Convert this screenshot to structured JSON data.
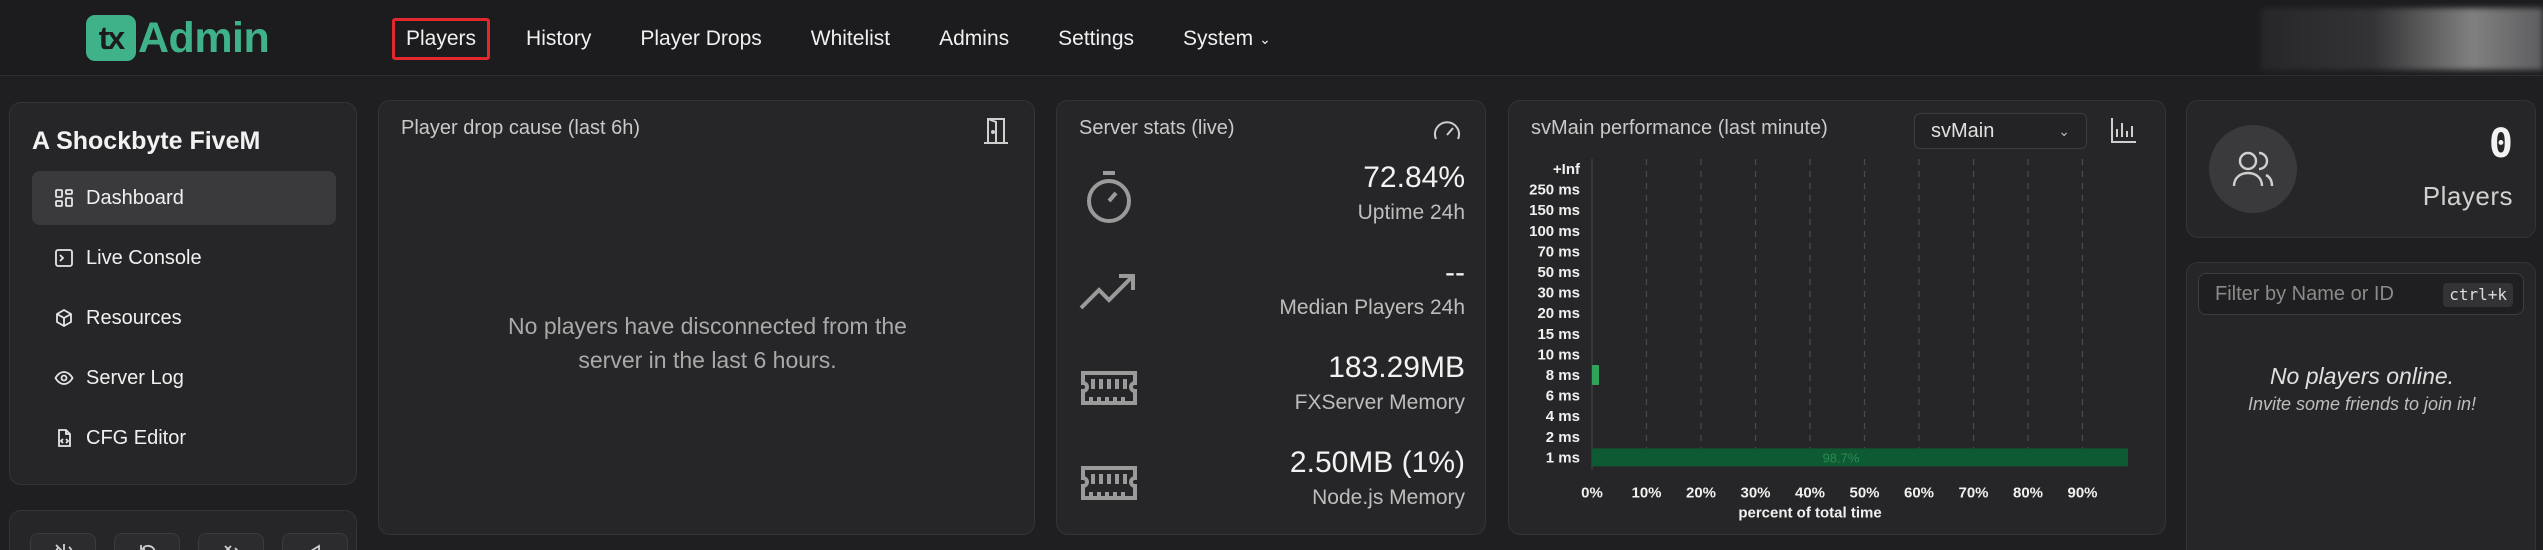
{
  "app": {
    "logo_badge": "tx",
    "logo_text": "Admin"
  },
  "nav": {
    "items": [
      {
        "label": "Players"
      },
      {
        "label": "History"
      },
      {
        "label": "Player Drops"
      },
      {
        "label": "Whitelist"
      },
      {
        "label": "Admins"
      },
      {
        "label": "Settings"
      },
      {
        "label": "System"
      }
    ]
  },
  "sidebar": {
    "server_name": "A Shockbyte FiveM",
    "items": [
      {
        "label": "Dashboard",
        "icon": "dashboard-icon"
      },
      {
        "label": "Live Console",
        "icon": "terminal-icon"
      },
      {
        "label": "Resources",
        "icon": "box-icon"
      },
      {
        "label": "Server Log",
        "icon": "eye-icon"
      },
      {
        "label": "CFG Editor",
        "icon": "file-code-icon"
      }
    ]
  },
  "drop_cause": {
    "title": "Player drop cause (last 6h)",
    "empty_line1": "No players have disconnected from the",
    "empty_line2": "server in the last 6 hours."
  },
  "server_stats": {
    "title": "Server stats (live)",
    "rows": [
      {
        "value": "72.84%",
        "label": "Uptime 24h",
        "icon": "timer-icon"
      },
      {
        "value": "--",
        "label": "Median Players 24h",
        "icon": "trending-up-icon"
      },
      {
        "value": "183.29MB",
        "label": "FXServer Memory",
        "icon": "memory-icon"
      },
      {
        "value": "2.50MB (1%)",
        "label": "Node.js Memory",
        "icon": "memory-icon"
      }
    ]
  },
  "perf": {
    "title": "svMain performance (last minute)",
    "thread_select": "svMain",
    "chart_data": {
      "type": "bar",
      "orientation": "horizontal",
      "categories": [
        "+Inf",
        "250 ms",
        "150 ms",
        "100 ms",
        "70 ms",
        "50 ms",
        "30 ms",
        "20 ms",
        "15 ms",
        "10 ms",
        "8 ms",
        "6 ms",
        "4 ms",
        "2 ms",
        "1 ms"
      ],
      "values": [
        0,
        0,
        0,
        0,
        0,
        0,
        0,
        0,
        0,
        0,
        0.01,
        0,
        0,
        0,
        0.99
      ],
      "xticks": [
        "0%",
        "10%",
        "20%",
        "30%",
        "40%",
        "50%",
        "60%",
        "70%",
        "80%",
        "90%"
      ],
      "xlabel": "percent of total time",
      "xlim": [
        0,
        1
      ],
      "bar_label": "98.7%",
      "colors": {
        "bar": "#0e5a32",
        "bar_small": "#2fa35a"
      },
      "grid": true
    }
  },
  "players": {
    "count": "0",
    "label": "Players",
    "filter_placeholder": "Filter by Name or ID",
    "shortcut": "ctrl+k",
    "empty_title": "No players online.",
    "empty_sub": "Invite some friends to join in!"
  }
}
